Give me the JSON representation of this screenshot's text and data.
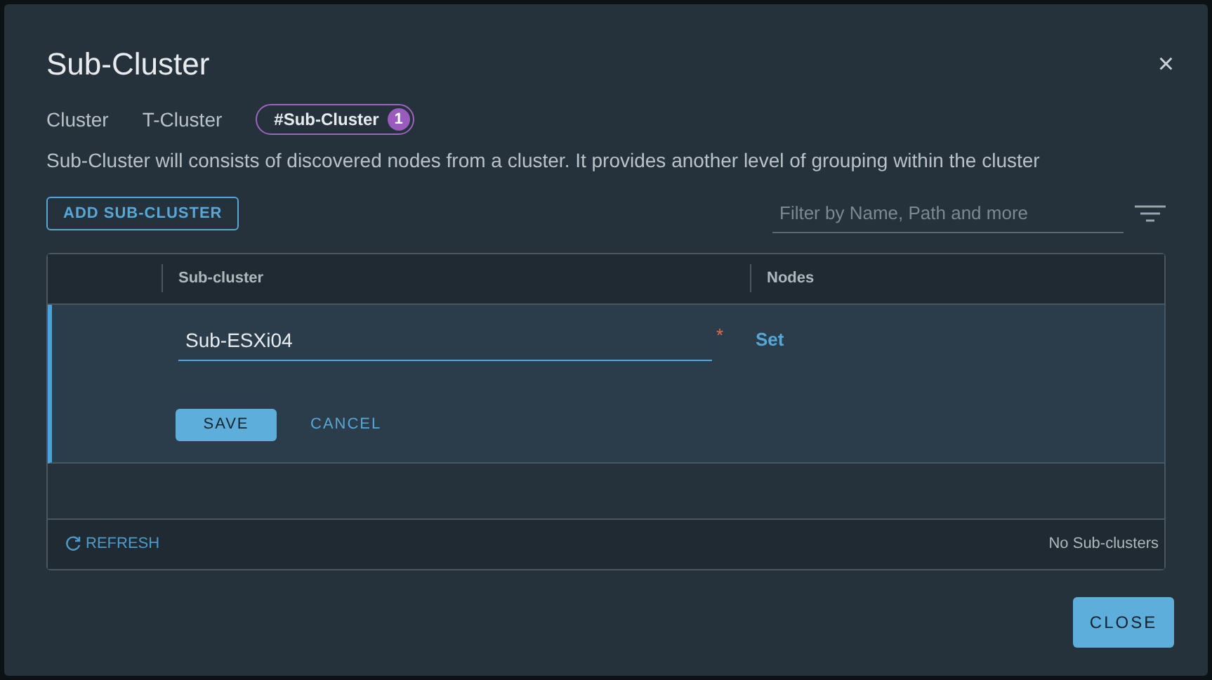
{
  "dialog": {
    "title": "Sub-Cluster",
    "close_glyph": "×"
  },
  "breadcrumbs": [
    {
      "label": "Cluster",
      "selected": false
    },
    {
      "label": "T-Cluster",
      "selected": false
    },
    {
      "label": "#Sub-Cluster",
      "selected": true,
      "badge": "1"
    }
  ],
  "description": "Sub-Cluster will consists of discovered nodes from a cluster. It provides another level of grouping within the cluster",
  "add_button": "ADD SUB-CLUSTER",
  "filter": {
    "placeholder": "Filter by Name, Path and more"
  },
  "table": {
    "columns": [
      "Sub-cluster",
      "Nodes"
    ],
    "edit_row": {
      "name_value": "Sub-ESXi04",
      "required_mark": "*",
      "nodes_link": "Set",
      "save": "SAVE",
      "cancel": "CANCEL"
    },
    "footer": {
      "refresh": "REFRESH",
      "status": "No Sub-clusters"
    }
  },
  "close_button": "CLOSE"
}
